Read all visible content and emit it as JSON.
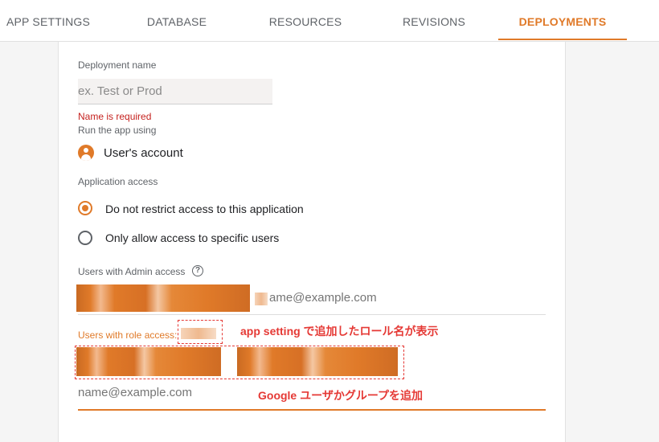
{
  "tabs": [
    {
      "label": "APP SETTINGS",
      "active": false
    },
    {
      "label": "DATABASE",
      "active": false
    },
    {
      "label": "RESOURCES",
      "active": false
    },
    {
      "label": "REVISIONS",
      "active": false
    },
    {
      "label": "DEPLOYMENTS",
      "active": true
    }
  ],
  "form": {
    "deployment_name_label": "Deployment name",
    "deployment_name_placeholder": "ex. Test or Prod",
    "deployment_name_value": "",
    "error_text": "Name is required",
    "run_as_label": "Run the app using",
    "run_as_value": "User's account",
    "access_label": "Application access",
    "access_options": [
      {
        "label": "Do not restrict access to this application",
        "selected": true
      },
      {
        "label": "Only allow access to specific users",
        "selected": false
      }
    ],
    "admin_label": "Users with Admin access",
    "admin_placeholder": "name@example.com",
    "admin_placeholder_visible": "ame@example.com",
    "role_label": "Users with role access:",
    "role_placeholder": "name@example.com"
  },
  "annotations": {
    "role_note": "app setting で追加したロール名が表示",
    "group_note": "Google ユーザかグループを追加"
  },
  "colors": {
    "accent": "#e07a29",
    "error": "#c5221f",
    "annotation": "#e53935"
  }
}
